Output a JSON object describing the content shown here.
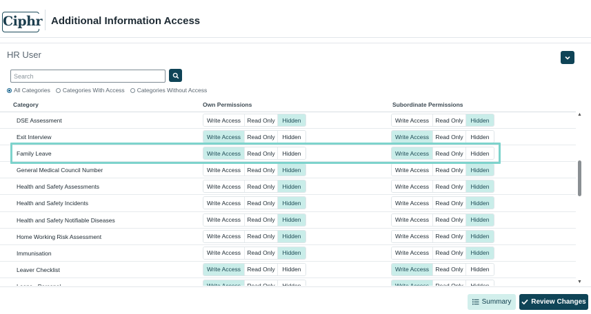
{
  "app": {
    "logo": "Ciphr",
    "title": "Additional Information Access"
  },
  "section": {
    "title": "HR User"
  },
  "search": {
    "placeholder": "Search",
    "value": ""
  },
  "filters": [
    {
      "label": "All Categories",
      "checked": true
    },
    {
      "label": "Categories With Access",
      "checked": false
    },
    {
      "label": "Categories Without Access",
      "checked": false
    }
  ],
  "columns": {
    "category": "Category",
    "own": "Own Permissions",
    "sub": "Subordinate Permissions"
  },
  "options": {
    "write": "Write Access",
    "read": "Read Only",
    "hidden": "Hidden"
  },
  "rows": [
    {
      "category": "DSE Assessment",
      "own": "hidden",
      "sub": "hidden"
    },
    {
      "category": "Exit Interview",
      "own": "write",
      "sub": "write"
    },
    {
      "category": "Family Leave",
      "own": "write",
      "sub": "write"
    },
    {
      "category": "General Medical Council Number",
      "own": "hidden",
      "sub": "hidden"
    },
    {
      "category": "Health and Safety Assessments",
      "own": "hidden",
      "sub": "hidden"
    },
    {
      "category": "Health and Safety Incidents",
      "own": "hidden",
      "sub": "hidden"
    },
    {
      "category": "Health and Safety Notifiable Diseases",
      "own": "hidden",
      "sub": "hidden"
    },
    {
      "category": "Home Working Risk Assessment",
      "own": "hidden",
      "sub": "hidden"
    },
    {
      "category": "Immunisation",
      "own": "hidden",
      "sub": "hidden"
    },
    {
      "category": "Leaver Checklist",
      "own": "write",
      "sub": "write"
    },
    {
      "category": "Loans - Personal",
      "own": "write",
      "sub": "write"
    }
  ],
  "footer": {
    "summary": "Summary",
    "review": "Review Changes"
  },
  "colors": {
    "primary": "#0f4457",
    "selected": "#c9ede9",
    "highlight": "#7dd3cc"
  }
}
